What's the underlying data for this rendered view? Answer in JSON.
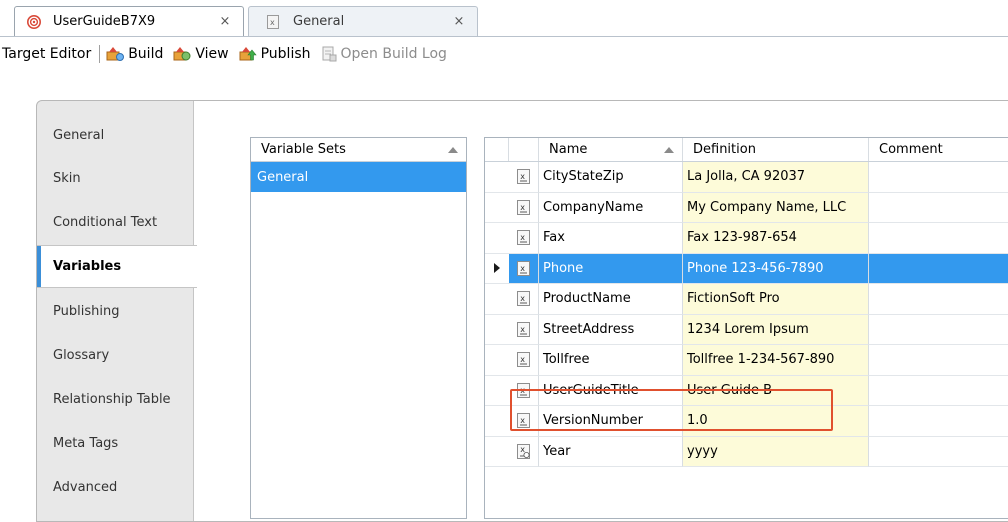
{
  "tabs": [
    {
      "label": "UserGuideB7X9",
      "close": "×",
      "active": true
    },
    {
      "label": "General",
      "close": "×",
      "active": false
    }
  ],
  "toolbar": {
    "title": "Target Editor",
    "build_label": "Build",
    "view_label": "View",
    "publish_label": "Publish",
    "build_log_label": "Open Build Log"
  },
  "nav": [
    {
      "label": "General"
    },
    {
      "label": "Skin"
    },
    {
      "label": "Conditional Text"
    },
    {
      "label": "Variables",
      "active": true
    },
    {
      "label": "Publishing"
    },
    {
      "label": "Glossary"
    },
    {
      "label": "Relationship Table"
    },
    {
      "label": "Meta Tags"
    },
    {
      "label": "Advanced"
    }
  ],
  "variable_sets": {
    "header": "Variable Sets",
    "items": [
      "General"
    ],
    "selected": "General"
  },
  "grid": {
    "columns": {
      "name": "Name",
      "definition": "Definition",
      "comment": "Comment"
    },
    "rows": [
      {
        "name": "CityStateZip",
        "definition": "La Jolla, CA 92037",
        "comment": "",
        "icon": "text-variable-icon"
      },
      {
        "name": "CompanyName",
        "definition": "My Company Name, LLC",
        "comment": "",
        "icon": "text-variable-icon"
      },
      {
        "name": "Fax",
        "definition": "Fax 123-987-654",
        "comment": "",
        "icon": "text-variable-icon"
      },
      {
        "name": "Phone",
        "definition": "Phone 123-456-7890",
        "comment": "",
        "icon": "text-variable-icon",
        "selected": true
      },
      {
        "name": "ProductName",
        "definition": "FictionSoft Pro",
        "comment": "",
        "icon": "text-variable-icon"
      },
      {
        "name": "StreetAddress",
        "definition": "1234 Lorem Ipsum",
        "comment": "",
        "icon": "text-variable-icon"
      },
      {
        "name": "Tollfree",
        "definition": "Tollfree 1-234-567-890",
        "comment": "",
        "icon": "text-variable-icon"
      },
      {
        "name": "UserGuideTitle",
        "definition": "User Guide B",
        "comment": "",
        "icon": "text-variable-icon",
        "highlighted": true
      },
      {
        "name": "VersionNumber",
        "definition": "1.0",
        "comment": "",
        "icon": "text-variable-icon"
      },
      {
        "name": "Year",
        "definition": "yyyy",
        "comment": "",
        "icon": "date-variable-icon"
      }
    ]
  },
  "colors": {
    "selection": "#3399ee",
    "definition_bg": "#fdfbd9",
    "highlight": "#e0502e",
    "active_nav_accent": "#3b8fd8"
  }
}
